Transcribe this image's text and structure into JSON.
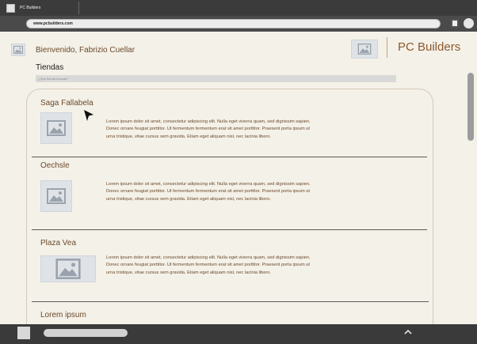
{
  "browser": {
    "tab_title": "PC Builders",
    "url": "www.pcbuilders.com"
  },
  "header": {
    "greeting": "Bienvenido, Fabrizio Cuellar",
    "brand": "PC Builders"
  },
  "stores_section": {
    "title": "Tiendas",
    "search_placeholder": "¿Qué tienda buscas?"
  },
  "stores": [
    {
      "name": "Saga Fallabela",
      "description": "Lorem ipsum dolor sit amet, consectetur adipiscing elit. Nulla eget viverra quam, sed dignissim sapien. Donec ornare feugiat porttitor. Ut fermentum fermentum erat sit amet porttitor. Praesent porta ipsum ut urna tristique, vitae cursus sem gravida. Etiam eget aliquam nisl, nec lacinia libero."
    },
    {
      "name": "Oechsle",
      "description": "Lorem ipsum dolor sit amet, consectetur adipiscing elit. Nulla eget viverra quam, sed dignissim sapien. Donec ornare feugiat porttitor. Ut fermentum fermentum erat sit amet porttitor. Praesent porta ipsum ut urna tristique, vitae cursus sem gravida. Etiam eget aliquam nisl, nec lacinia libero."
    },
    {
      "name": "Plaza Vea",
      "description": "Lorem ipsum dolor sit amet, consectetur adipiscing elit. Nulla eget viverra quam, sed dignissim sapien. Donec ornare feugiat porttitor. Ut fermentum fermentum erat sit amet porttitor. Praesent porta ipsum ut urna tristique, vitae cursus sem gravida. Etiam eget aliquam nisl, nec lacinia libero."
    },
    {
      "name": "Lorem ipsum",
      "description": ""
    }
  ],
  "icons": {
    "image_placeholder": "image-placeholder-icon",
    "cursor": "mouse-pointer-icon",
    "chevron": "chevron-up-icon"
  },
  "colors": {
    "page_background": "#f4f1e8",
    "accent_text": "#6b4a2c",
    "brand": "#8a5a2e",
    "chrome": "#3b3b3b"
  }
}
